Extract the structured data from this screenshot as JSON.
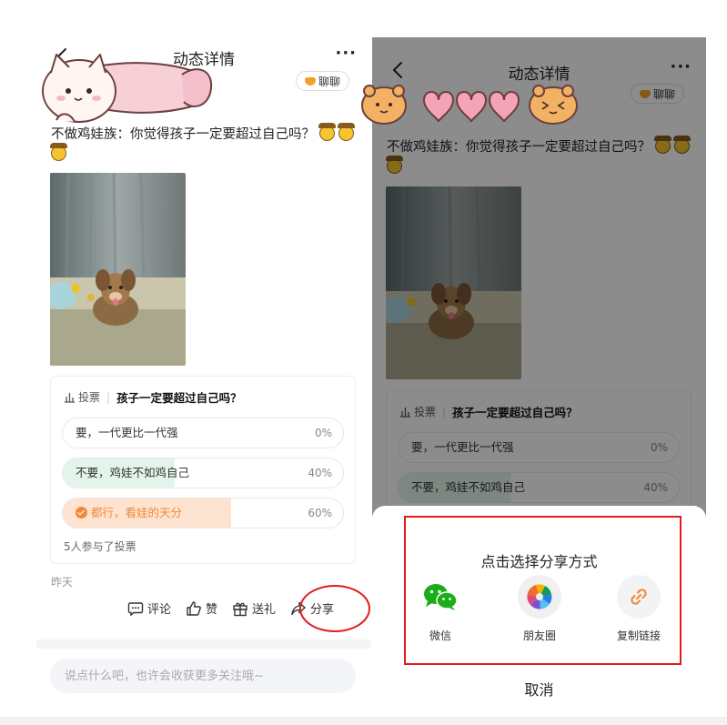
{
  "left": {
    "nav": {
      "title": "动态详情",
      "more": "···"
    },
    "chat_label": "聊聊",
    "post_text": "不做鸡娃族：你觉得孩子一定要超过自己吗？",
    "vote": {
      "tag": "投票",
      "question": "孩子一定要超过自己吗？",
      "options": [
        {
          "label": "要，一代更比一代强",
          "percent": "0%",
          "fill": 0
        },
        {
          "label": "不要，鸡娃不如鸡自己",
          "percent": "40%",
          "fill": 0.4
        },
        {
          "label": "都行，看娃的天分",
          "percent": "60%",
          "fill": 0.6
        }
      ],
      "participants": "5人参与了投票"
    },
    "time": "昨天",
    "actions": {
      "comment": "评论",
      "like": "赞",
      "gift": "送礼",
      "share": "分享"
    },
    "comment_placeholder": "说点什么吧，也许会收获更多关注哦~"
  },
  "right": {
    "nav": {
      "title": "动态详情",
      "more": "···"
    },
    "chat_label": "聊聊",
    "post_text": "不做鸡娃族：你觉得孩子一定要超过自己吗？",
    "vote": {
      "tag": "投票",
      "question": "孩子一定要超过自己吗？",
      "options": [
        {
          "label": "要，一代更比一代强",
          "percent": "0%"
        },
        {
          "label": "不要，鸡娃不如鸡自己",
          "percent": "40%"
        }
      ]
    },
    "share_sheet": {
      "title": "点击选择分享方式",
      "options": [
        {
          "label": "微信",
          "icon": "wechat-icon"
        },
        {
          "label": "朋友圈",
          "icon": "moments-icon"
        },
        {
          "label": "复制链接",
          "icon": "link-icon"
        }
      ],
      "cancel": "取消"
    }
  },
  "colors": {
    "highlight_red": "#e31b1b",
    "vote_green_fill": "#e3f5ea",
    "vote_orange_fill": "#fde3d0",
    "vote_orange_text": "#f08a3a",
    "wechat_green": "#1aad19",
    "link_orange": "#f08a3a"
  }
}
